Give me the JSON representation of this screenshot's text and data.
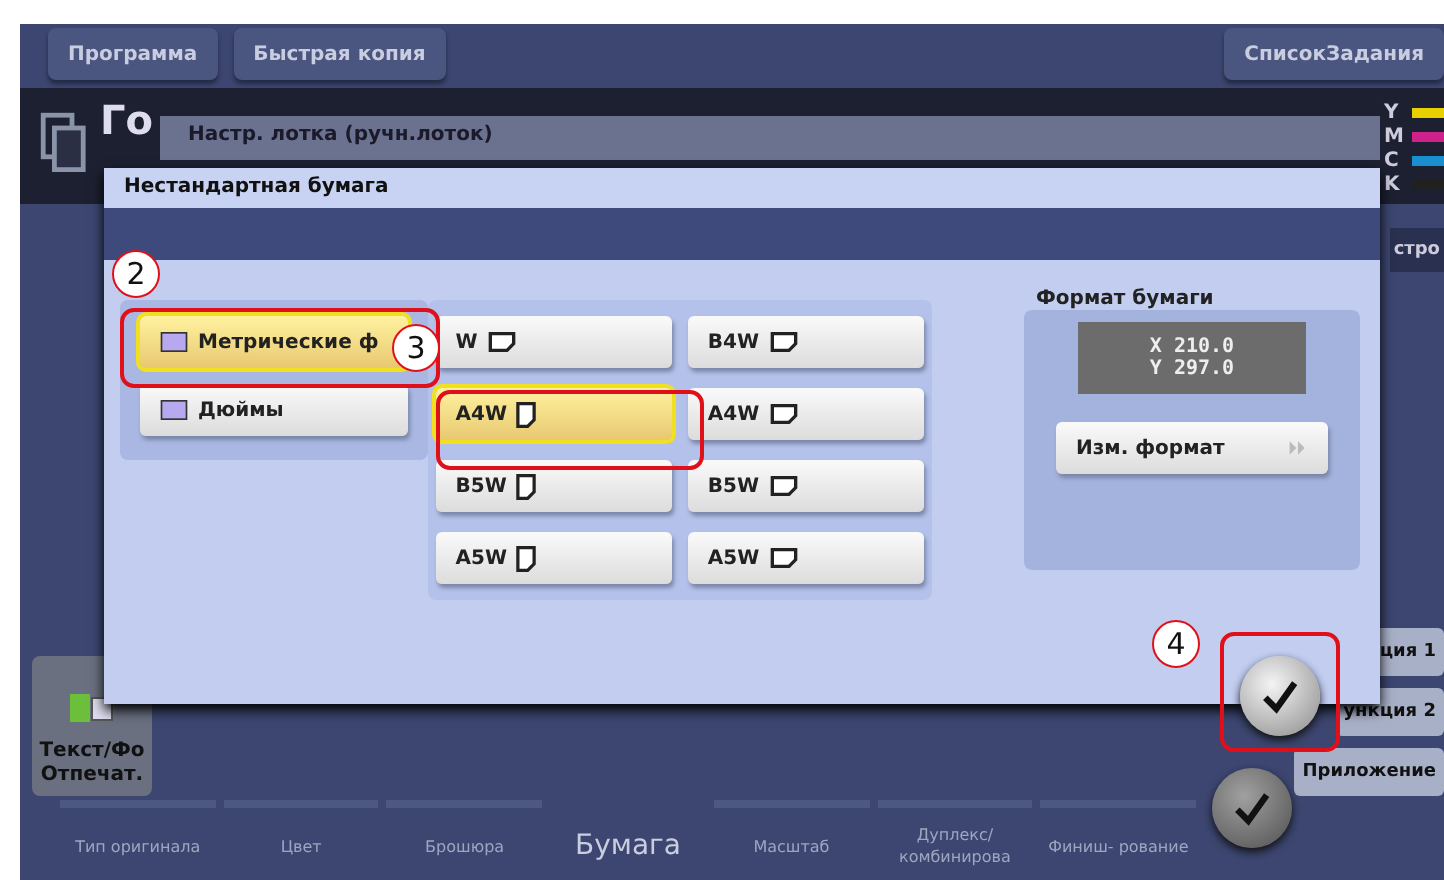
{
  "top_bar": {
    "left_buttons": [
      "Программа",
      "Быстрая копия"
    ],
    "right_button": "СписокЗадания"
  },
  "status": {
    "title": "Го",
    "toner": [
      {
        "label": "Y",
        "color": "#e8d000"
      },
      {
        "label": "M",
        "color": "#d0208a"
      },
      {
        "label": "C",
        "color": "#1a8fd0"
      },
      {
        "label": "K",
        "color": "#202020"
      }
    ],
    "side_tab": "стро"
  },
  "left_button": {
    "lines": [
      "Текст/Фо",
      "Отпечат."
    ]
  },
  "bottom_tabs": [
    {
      "label": "Тип оригинала",
      "selected": false
    },
    {
      "label": "Цвет",
      "selected": false
    },
    {
      "label": "Брошюра",
      "selected": false
    },
    {
      "label": "Бумага",
      "selected": true
    },
    {
      "label": "Масштаб",
      "selected": false
    },
    {
      "label": "Дуплекс/ комбинирова",
      "selected": false
    },
    {
      "label": "Финиш- рование",
      "selected": false
    }
  ],
  "right_buttons": [
    "ция 1",
    "ункция 2",
    "Приложение"
  ],
  "tray_dialog": {
    "title": "Настр. лотка (ручн.лоток)"
  },
  "custom_dialog": {
    "title": "Нестандартная бумага",
    "units": [
      {
        "label": "Метрические ф",
        "selected": true
      },
      {
        "label": "Дюймы",
        "selected": false
      }
    ],
    "sizes": [
      [
        {
          "label": "W",
          "kind": "landscape",
          "selected": false
        },
        {
          "label": "A4W",
          "kind": "portrait",
          "selected": true
        },
        {
          "label": "B5W",
          "kind": "portrait",
          "selected": false
        },
        {
          "label": "A5W",
          "kind": "portrait",
          "selected": false
        }
      ],
      [
        {
          "label": "B4W",
          "kind": "landscape",
          "selected": false
        },
        {
          "label": "A4W",
          "kind": "landscape",
          "selected": false
        },
        {
          "label": "B5W",
          "kind": "landscape",
          "selected": false
        },
        {
          "label": "A5W",
          "kind": "landscape",
          "selected": false
        }
      ]
    ],
    "format_label": "Формат бумаги",
    "format_x": "X 210.0",
    "format_y": "Y 297.0",
    "change_button": "Изм. формат"
  },
  "callouts": [
    "2",
    "3",
    "4"
  ]
}
